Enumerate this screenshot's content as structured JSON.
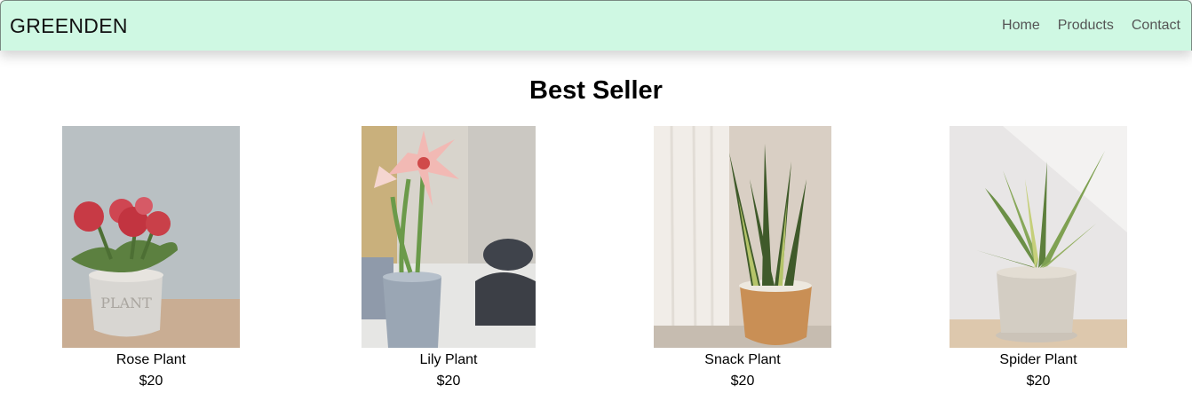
{
  "brand": "GREENDEN",
  "nav": [
    "Home",
    "Products",
    "Contact"
  ],
  "section_title": "Best Seller",
  "products": [
    {
      "name": "Rose Plant",
      "price": "$20"
    },
    {
      "name": "Lily Plant",
      "price": "$20"
    },
    {
      "name": "Snack Plant",
      "price": "$20"
    },
    {
      "name": "Spider Plant",
      "price": "$20"
    }
  ],
  "colors": {
    "navbar_bg": "#cff8e3",
    "text": "#000000",
    "nav_link": "#555555"
  }
}
